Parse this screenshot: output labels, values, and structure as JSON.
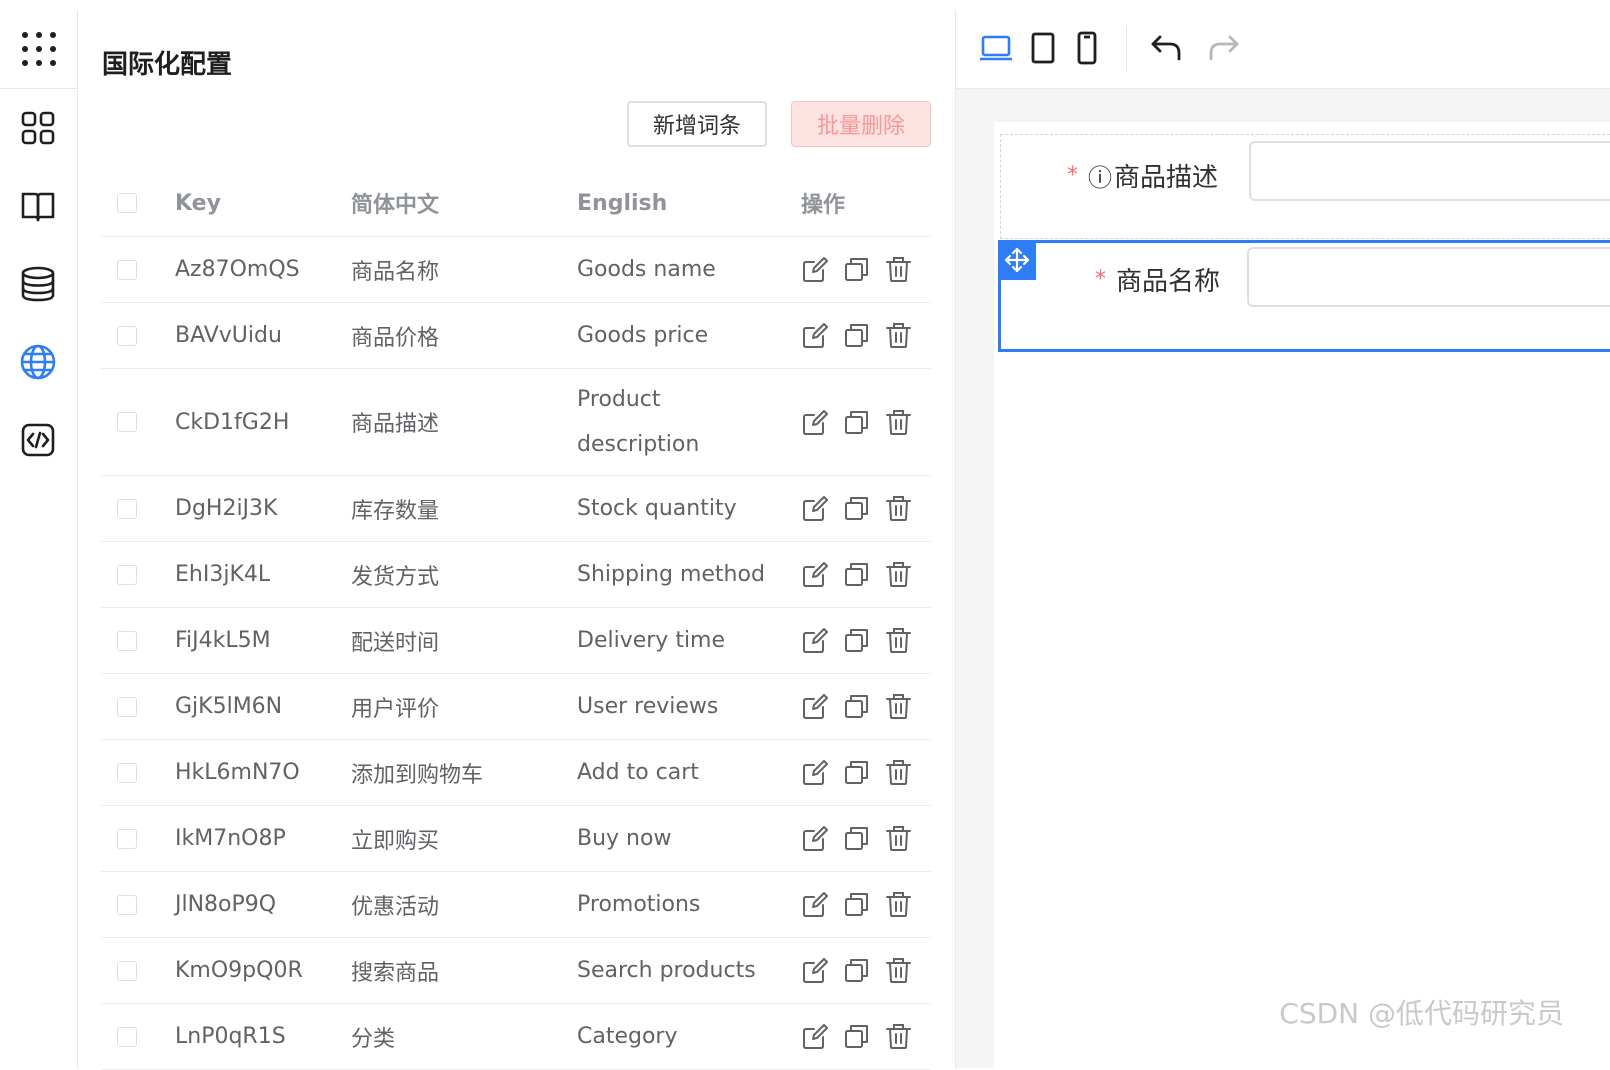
{
  "panel": {
    "title": "国际化配置"
  },
  "buttons": {
    "add": "新增词条",
    "batch_delete": "批量删除"
  },
  "table": {
    "headers": {
      "key": "Key",
      "zh": "简体中文",
      "en": "English",
      "ops": "操作"
    },
    "rows": [
      {
        "key": "Az87OmQS",
        "zh": "商品名称",
        "en": "Goods name"
      },
      {
        "key": "BAVvUidu",
        "zh": "商品价格",
        "en": "Goods price"
      },
      {
        "key": "CkD1fG2H",
        "zh": "商品描述",
        "en": "Product description"
      },
      {
        "key": "DgH2iJ3K",
        "zh": "库存数量",
        "en": "Stock quantity"
      },
      {
        "key": "EhI3jK4L",
        "zh": "发货方式",
        "en": "Shipping method"
      },
      {
        "key": "FiJ4kL5M",
        "zh": "配送时间",
        "en": "Delivery time"
      },
      {
        "key": "GjK5lM6N",
        "zh": "用户评价",
        "en": "User reviews"
      },
      {
        "key": "HkL6mN7O",
        "zh": "添加到购物车",
        "en": "Add to cart"
      },
      {
        "key": "IkM7nO8P",
        "zh": "立即购买",
        "en": "Buy now"
      },
      {
        "key": "JlN8oP9Q",
        "zh": "优惠活动",
        "en": "Promotions"
      },
      {
        "key": "KmO9pQ0R",
        "zh": "搜索商品",
        "en": "Search products"
      },
      {
        "key": "LnP0qR1S",
        "zh": "分类",
        "en": "Category"
      }
    ]
  },
  "designer": {
    "field1_label": "商品描述",
    "field2_label": "商品名称",
    "required_mark": "*",
    "info_glyph": "ⓘ"
  },
  "watermark": "CSDN @低代码研究员",
  "colors": {
    "primary": "#2f7df6",
    "danger_light": "#fde2e2",
    "required": "#f56c6c"
  }
}
